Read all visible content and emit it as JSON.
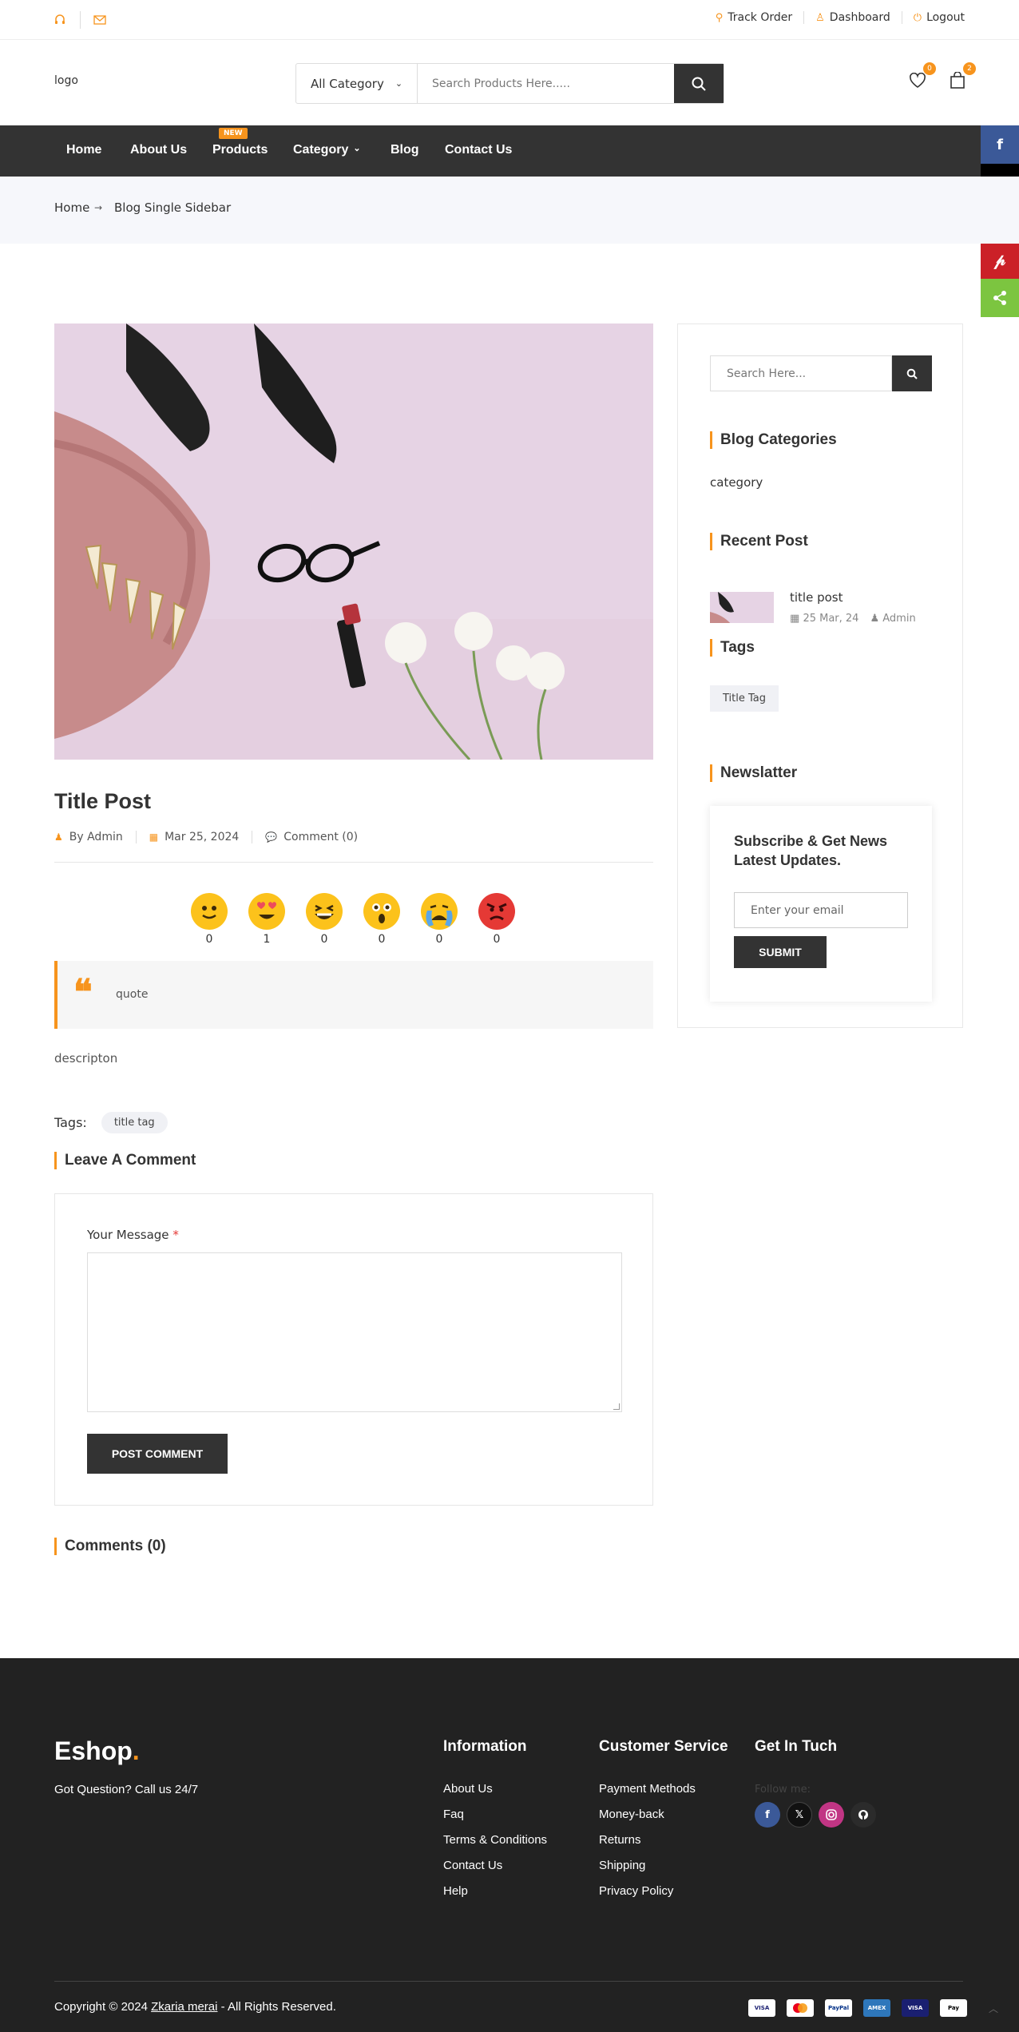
{
  "topbar": {
    "links": [
      {
        "label": "Track Order",
        "icon": "map-pin-icon"
      },
      {
        "label": "Dashboard",
        "icon": "user-icon"
      },
      {
        "label": "Logout",
        "icon": "power-icon"
      }
    ]
  },
  "header": {
    "logo_alt": "logo",
    "category_select": "All Category",
    "search_placeholder": "Search Products Here.....",
    "wishlist_count": "0",
    "cart_count": "2"
  },
  "nav": {
    "items": [
      "Home",
      "About Us",
      "Products",
      "Category",
      "Blog",
      "Contact Us"
    ],
    "new_badge": "NEW"
  },
  "breadcrumb": {
    "home": "Home",
    "current": "Blog Single Sidebar"
  },
  "post": {
    "title": "Title Post",
    "author": "By Admin",
    "date": "Mar 25, 2024",
    "comments": "Comment (0)",
    "reactions": [
      {
        "name": "smile",
        "count": "0"
      },
      {
        "name": "love",
        "count": "1"
      },
      {
        "name": "laugh",
        "count": "0"
      },
      {
        "name": "wow",
        "count": "0"
      },
      {
        "name": "sad",
        "count": "0"
      },
      {
        "name": "angry",
        "count": "0"
      }
    ],
    "quote": "quote",
    "description": "descripton",
    "tags_label": "Tags:",
    "tag": "title tag"
  },
  "comment_form": {
    "heading": "Leave A Comment",
    "message_label": "Your Message",
    "required_mark": "*",
    "submit": "POST COMMENT",
    "comments_heading": "Comments (0)"
  },
  "sidebar": {
    "search_placeholder": "Search Here...",
    "categories_heading": "Blog Categories",
    "category": "category",
    "recent_heading": "Recent Post",
    "recent_title": "title post",
    "recent_date": "25 Mar, 24",
    "recent_author": "Admin",
    "tags_heading": "Tags",
    "tag": "Title Tag",
    "newsletter_heading": "Newslatter",
    "newsletter_text": "Subscribe & Get News Latest Updates.",
    "email_placeholder": "Enter your email",
    "submit": "SUBMIT"
  },
  "footer": {
    "brand": "Eshop",
    "brand_dot": ".",
    "tagline": "Got Question? Call us 24/7",
    "info_heading": "Information",
    "info_links": [
      "About Us",
      "Faq",
      "Terms & Conditions",
      "Contact Us",
      "Help"
    ],
    "service_heading": "Customer Service",
    "service_links": [
      "Payment Methods",
      "Money-back",
      "Returns",
      "Shipping",
      "Privacy Policy"
    ],
    "touch_heading": "Get In Tuch",
    "follow": "Follow me:",
    "copyright_pre": "Copyright © 2024",
    "copyright_name": "Zkaria merai",
    "copyright_post": "- All Rights Reserved.",
    "payments": [
      "VISA",
      "MC",
      "PayPal",
      "AMEX",
      "VISA",
      "Pay"
    ]
  },
  "colors": {
    "accent": "#f7941d",
    "dark": "#333333",
    "footer": "#222222"
  }
}
